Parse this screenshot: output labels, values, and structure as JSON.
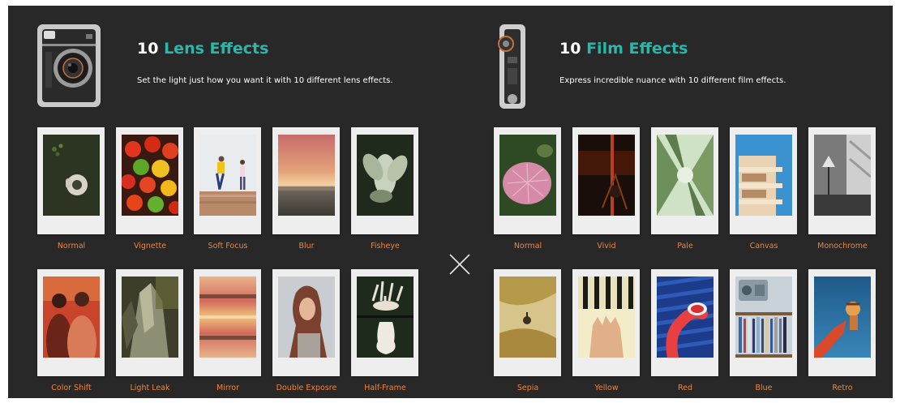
{
  "lens": {
    "count": "10",
    "title": "Lens Effects",
    "subtitle": "Set the light just how you want it with 10 different lens effects.",
    "effects": [
      "Normal",
      "Vignette",
      "Soft Focus",
      "Blur",
      "Fisheye",
      "Color Shift",
      "Light Leak",
      "Mirror",
      "Double Exposre",
      "Half-Frame"
    ]
  },
  "film": {
    "count": "10",
    "title": "Film Effects",
    "subtitle": "Express incredible nuance with 10 different film effects.",
    "effects": [
      "Normal",
      "Vivid",
      "Pale",
      "Canvas",
      "Monochrome",
      "Sepia",
      "Yellow",
      "Red",
      "Blue",
      "Retro"
    ]
  },
  "colors": {
    "background": "#282828",
    "accent": "#2ab7a9",
    "label": "#f0843c"
  },
  "icons": {
    "separator": "multiply-icon"
  }
}
